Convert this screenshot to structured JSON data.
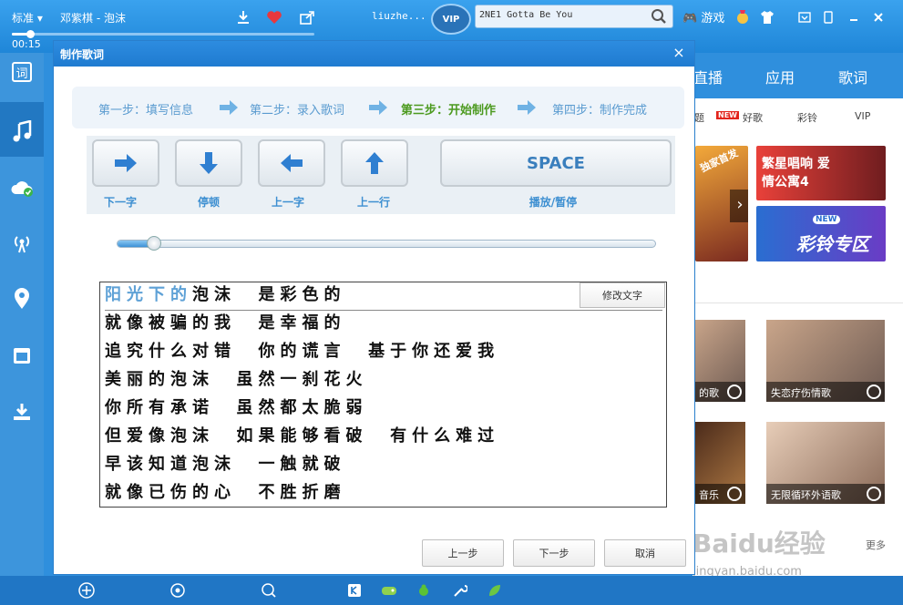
{
  "player": {
    "quality": "标准",
    "quality_arrow": "▾",
    "song_title": "邓紫棋 - 泡沫",
    "time": "00:15",
    "progress_fraction": 0.06,
    "username": "liuzhe...",
    "vip_label": "VIP",
    "search_text": "2NE1 Gotta Be You",
    "game_label": "游戏",
    "lyric_toggle_label": "词"
  },
  "right_panel": {
    "nav": [
      "直播",
      "应用",
      "歌词"
    ],
    "sub_tabs": [
      "题",
      "NEW",
      "好歌",
      "彩铃",
      "VIP"
    ],
    "promo_1_text": "繁星唱响 爱情公寓4",
    "promo_2_text": "彩铃专区",
    "promo_2_badge": "NEW",
    "promo_side_text": "独家首发",
    "cards": [
      "的歌",
      "失恋疗伤情歌",
      "音乐",
      "无限循环外语歌"
    ],
    "more": "更多",
    "watermark": "Baidu经验",
    "watermark_sub": "jingyan.baidu.com"
  },
  "dialog": {
    "title": "制作歌词",
    "close": "×",
    "steps": [
      {
        "label": "第一步：填写信息",
        "active": false
      },
      {
        "label": "第二步：录入歌词",
        "active": false
      },
      {
        "label": "第三步：开始制作",
        "active": true
      },
      {
        "label": "第四步：制作完成",
        "active": false
      }
    ],
    "controls": [
      {
        "label": "下一字",
        "icon": "arrow-right-icon"
      },
      {
        "label": "停顿",
        "icon": "arrow-down-icon"
      },
      {
        "label": "上一字",
        "icon": "arrow-left-icon"
      },
      {
        "label": "上一行",
        "icon": "arrow-up-icon"
      }
    ],
    "space_key": "SPACE",
    "space_label": "播放/暂停",
    "playback_fraction": 0.05,
    "edit_button": "修改文字",
    "current_line": {
      "done": "阳光下的",
      "rest": "泡沫  是彩色的"
    },
    "lyrics": [
      "就像被骗的我  是幸福的",
      "追究什么对错  你的谎言  基于你还爱我",
      "美丽的泡沫  虽然一刹花火",
      "你所有承诺  虽然都太脆弱",
      "但爱像泡沫  如果能够看破  有什么难过",
      "早该知道泡沫  一触就破",
      "就像已伤的心  不胜折磨"
    ],
    "buttons": {
      "prev": "上一步",
      "next": "下一步",
      "cancel": "取消"
    }
  },
  "colors": {
    "brand_blue": "#2f8fdd",
    "step_active": "#4c9a1f",
    "step_inactive": "#5a9bd0"
  }
}
